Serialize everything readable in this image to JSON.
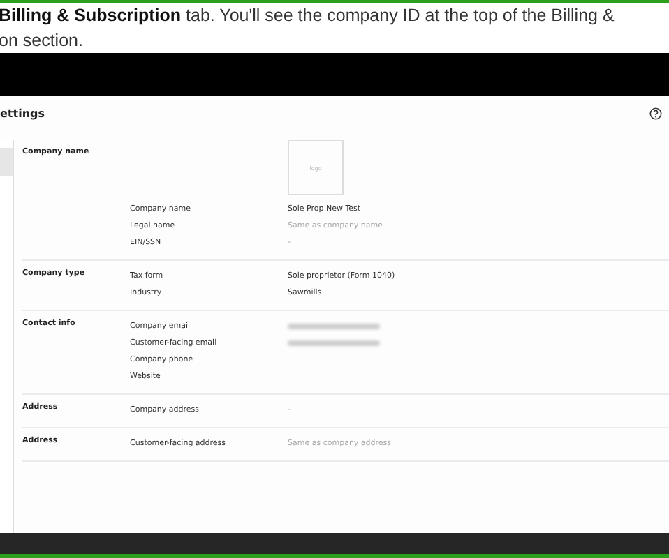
{
  "instruction": {
    "lines": [
      "**Billing & Subscription** tab. You'll see the company ID at the top of the Billing &",
      "on section."
    ]
  },
  "settings": {
    "title": "ettings",
    "logo_placeholder": "logo",
    "sections": [
      {
        "name": "Company name",
        "kind": "logo",
        "fields": [
          {
            "label": "Company name",
            "value": "Sole Prop New Test",
            "muted": false
          },
          {
            "label": "Legal name",
            "value": "Same as company name",
            "muted": true
          },
          {
            "label": "EIN/SSN",
            "value": "-",
            "muted": true
          }
        ]
      },
      {
        "name": "Company type",
        "kind": "plain",
        "fields": [
          {
            "label": "Tax form",
            "value": "Sole proprietor (Form 1040)",
            "muted": false
          },
          {
            "label": "Industry",
            "value": "Sawmills",
            "muted": false
          }
        ]
      },
      {
        "name": "Contact info",
        "kind": "plain",
        "fields": [
          {
            "label": "Company email",
            "kind": "redacted"
          },
          {
            "label": "Customer-facing email",
            "kind": "redacted"
          },
          {
            "label": "Company phone"
          },
          {
            "label": "Website"
          }
        ]
      },
      {
        "name": "Address",
        "kind": "plain",
        "fields": [
          {
            "label": "Company address",
            "value": "-",
            "muted": true
          }
        ]
      },
      {
        "name": "Address",
        "kind": "plain",
        "fields": [
          {
            "label": "Customer-facing address",
            "value": "Same as company address",
            "muted": true
          }
        ]
      }
    ]
  }
}
